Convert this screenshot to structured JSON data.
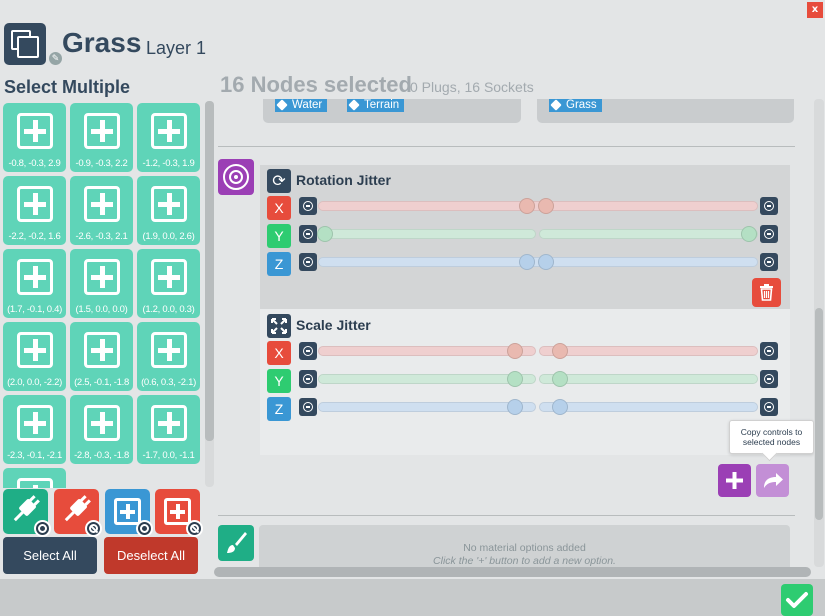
{
  "window": {
    "close_label": "x"
  },
  "header": {
    "title": "Grass",
    "layer": "Layer 1"
  },
  "left": {
    "heading": "Select Multiple",
    "tiles": [
      "-0.8, -0.3, 2.9",
      "-0.9, -0.3, 2.2",
      "-1.2, -0.3, 1.9",
      "-2.2, -0.2, 1.6",
      "-2.6, -0.3, 2.1",
      "(1.9, 0.0, 2.6)",
      "(1.7, -0.1, 0.4)",
      "(1.5, 0.0, 0.0)",
      "(1.2, 0.0, 0.3)",
      "(2.0, 0.0, -2.2)",
      "(2.5, -0.1, -1.8",
      "(0.6, 0.3, -2.1)",
      "-2.3, -0.1, -2.1",
      "-2.8, -0.3, -1.8",
      "-1.7, 0.0, -1.1"
    ],
    "select_all": "Select All",
    "deselect_all": "Deselect All"
  },
  "main": {
    "title": "16 Nodes selected",
    "subtitle": "0 Plugs, 16 Sockets",
    "tags_left": [
      "Water",
      "Terrain"
    ],
    "tags_right": [
      "Grass"
    ],
    "rotation_jitter": {
      "title": "Rotation Jitter",
      "axes": [
        "X",
        "Y",
        "Z"
      ]
    },
    "scale_jitter": {
      "title": "Scale Jitter",
      "axes": [
        "X",
        "Y",
        "Z"
      ]
    },
    "tooltip": {
      "line1": "Copy controls to",
      "line2": "selected nodes"
    },
    "material": {
      "line1": "No material options added",
      "line2": "Click the '+' button to add a new option."
    }
  },
  "colors": {
    "tile": "#5fd4b8",
    "dark": "#34495e",
    "red": "#e74c3c",
    "blue": "#3a97d4",
    "green": "#2ecc71",
    "purple": "#9b3fb5"
  }
}
